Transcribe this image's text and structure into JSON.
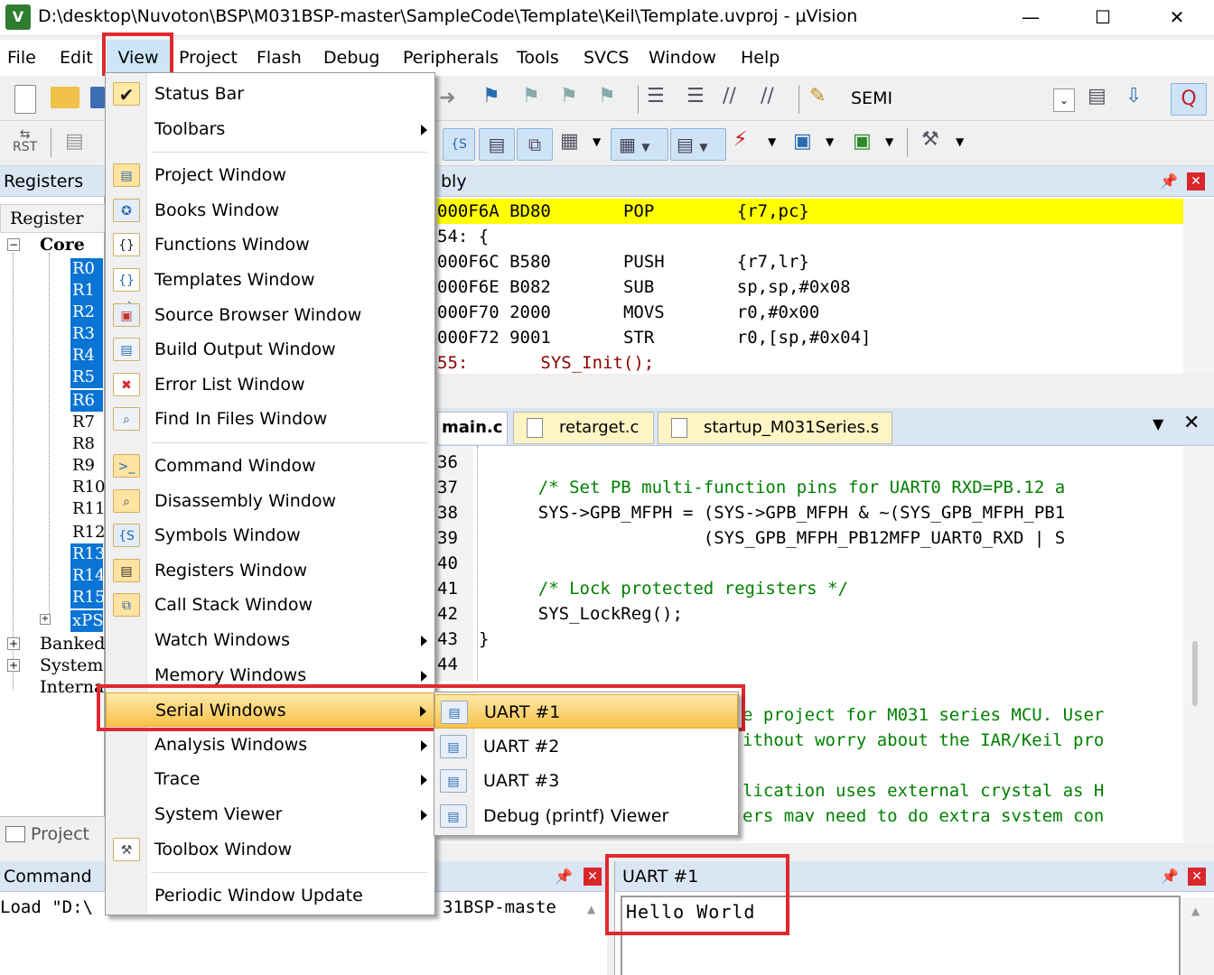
{
  "window": {
    "title": "D:\\desktop\\Nuvoton\\BSP\\M031BSP-master\\SampleCode\\Template\\Keil\\Template.uvproj - µVision",
    "app_icon": "uv-icon"
  },
  "menubar": [
    "File",
    "Edit",
    "View",
    "Project",
    "Flash",
    "Debug",
    "Peripherals",
    "Tools",
    "SVCS",
    "Window",
    "Help"
  ],
  "toolbar": {
    "target_label": "SEMI",
    "rst_label": "RST"
  },
  "registers": {
    "panel_title": "Registers",
    "column_header": "Register",
    "core_label": "Core",
    "core_regs": [
      "R0",
      "R1",
      "R2",
      "R3",
      "R4",
      "R5",
      "R6",
      "R7",
      "R8",
      "R9",
      "R10",
      "R11",
      "R12",
      "R13",
      "R14",
      "R15",
      "xPSR"
    ],
    "highlighted": [
      "R0",
      "R1",
      "R2",
      "R3",
      "R4",
      "R5",
      "R6",
      "R13",
      "R14",
      "R15",
      "xPSR"
    ],
    "groups": [
      "Banked",
      "System",
      "Internal"
    ]
  },
  "project_tab": "Project",
  "disassembly": {
    "panel_title": "bly",
    "lines": [
      {
        "addr": "000F6A",
        "code": "BD80",
        "op": "POP",
        "args": "{r7,pc}",
        "current": true
      },
      {
        "src": "54: {"
      },
      {
        "addr": "000F6C",
        "code": "B580",
        "op": "PUSH",
        "args": "{r7,lr}"
      },
      {
        "addr": "000F6E",
        "code": "B082",
        "op": "SUB",
        "args": "sp,sp,#0x08"
      },
      {
        "addr": "000F70",
        "code": "2000",
        "op": "MOVS",
        "args": "r0,#0x00"
      },
      {
        "addr": "000F72",
        "code": "9001",
        "op": "STR",
        "args": "r0,[sp,#0x04]"
      },
      {
        "src": "55:       SYS_Init();"
      }
    ]
  },
  "editor": {
    "tabs": [
      "main.c",
      "retarget.c",
      "startup_M031Series.s"
    ],
    "line_numbers": [
      "36",
      "37",
      "38",
      "39",
      "40",
      "41",
      "42",
      "43",
      "44"
    ],
    "lines": [
      "",
      "    /* Set PB multi-function pins for UART0 RXD=PB.12 a",
      "    SYS->GPB_MFPH = (SYS->GPB_MFPH & ~(SYS_GPB_MFPH_PB1",
      "                    (SYS_GPB_MFPH_PB12MFP_UART0_RXD | S",
      "",
      "    /* Lock protected registers */",
      "    SYS_LockReg();",
      "}",
      ""
    ],
    "lower_lines": [
      "e project for M031 series MCU. User",
      "ithout worry about the IAR/Keil pro",
      "",
      "lication uses external crystal as H",
      "ers may need to do extra system con"
    ]
  },
  "command": {
    "panel_title": "Command",
    "text_left": "Load \"D:\\",
    "text_right": "31BSP-maste"
  },
  "uart": {
    "panel_title": "UART #1",
    "output": "Hello World"
  },
  "view_menu": {
    "items": [
      {
        "label": "Status Bar",
        "icon": "check-icon",
        "checked": true
      },
      {
        "label": "Toolbars",
        "icon": "",
        "submenu": true,
        "sep_after": true
      },
      {
        "label": "Project Window",
        "icon": "project-window-icon"
      },
      {
        "label": "Books Window",
        "icon": "books-window-icon"
      },
      {
        "label": "Functions Window",
        "icon": "functions-window-icon"
      },
      {
        "label": "Templates Window",
        "icon": "templates-window-icon"
      },
      {
        "label": "Source Browser Window",
        "icon": "source-browser-icon"
      },
      {
        "label": "Build Output Window",
        "icon": "build-output-icon"
      },
      {
        "label": "Error List Window",
        "icon": "error-list-icon"
      },
      {
        "label": "Find In Files Window",
        "icon": "find-in-files-icon",
        "sep_after": true
      },
      {
        "label": "Command Window",
        "icon": "command-window-icon"
      },
      {
        "label": "Disassembly Window",
        "icon": "disassembly-window-icon"
      },
      {
        "label": "Symbols Window",
        "icon": "symbols-window-icon"
      },
      {
        "label": "Registers Window",
        "icon": "registers-window-icon"
      },
      {
        "label": "Call Stack Window",
        "icon": "call-stack-icon"
      },
      {
        "label": "Watch Windows",
        "icon": "",
        "submenu": true
      },
      {
        "label": "Memory Windows",
        "icon": "",
        "submenu": true
      },
      {
        "label": "Serial Windows",
        "icon": "",
        "submenu": true,
        "highlighted": true
      },
      {
        "label": "Analysis Windows",
        "icon": "",
        "submenu": true
      },
      {
        "label": "Trace",
        "icon": "",
        "submenu": true
      },
      {
        "label": "System Viewer",
        "icon": "",
        "submenu": true
      },
      {
        "label": "Toolbox Window",
        "icon": "toolbox-icon",
        "sep_after": true
      },
      {
        "label": "Periodic Window Update",
        "icon": ""
      }
    ]
  },
  "serial_submenu": {
    "items": [
      {
        "label": "UART #1",
        "highlighted": true
      },
      {
        "label": "UART #2"
      },
      {
        "label": "UART #3"
      },
      {
        "label": "Debug (printf) Viewer"
      }
    ]
  },
  "colors": {
    "highlight_box": "#e0282e",
    "selection": "#0a74d4",
    "current_line": "#ffff00",
    "comment": "#008000"
  }
}
